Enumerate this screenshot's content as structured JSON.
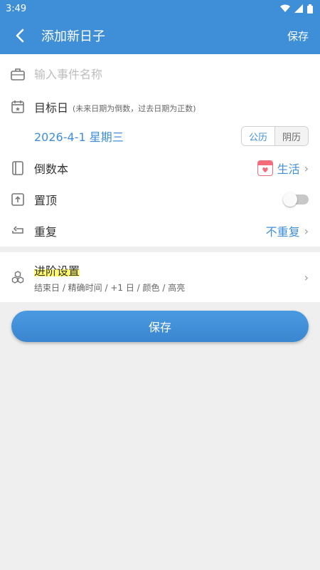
{
  "status_bar": {
    "time": "3:49"
  },
  "app_bar": {
    "title": "添加新日子",
    "save_label": "保存"
  },
  "form": {
    "name_placeholder": "输入事件名称",
    "target": {
      "label": "目标日",
      "hint": "(未来日期为倒数，过去日期为正数)"
    },
    "date": {
      "value": "2026-4-1 星期三",
      "calendar_options": [
        "公历",
        "阴历"
      ],
      "selected": "公历"
    },
    "book": {
      "label": "倒数本",
      "value": "生活"
    },
    "pin": {
      "label": "置顶",
      "on": false
    },
    "repeat": {
      "label": "重复",
      "value": "不重复"
    }
  },
  "advanced": {
    "title": "进阶设置",
    "subtitle": "结束日 / 精确时间 / +1 日 / 颜色 / 高亮"
  },
  "save_button": "保存",
  "colors": {
    "primary": "#3f8fd8",
    "highlight": "#fff96b",
    "book_icon": "#f26b7a"
  }
}
